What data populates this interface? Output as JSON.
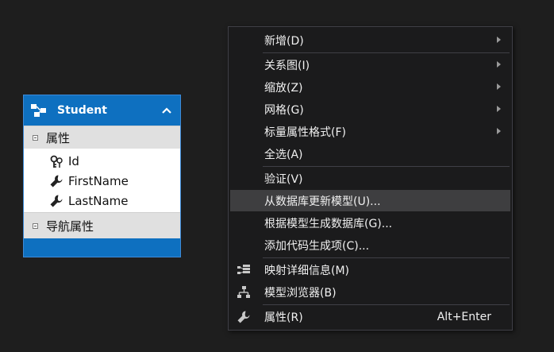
{
  "entity": {
    "title": "Student",
    "sections": [
      {
        "label": "属性",
        "properties": [
          {
            "name": "Id",
            "icon": "key-icon"
          },
          {
            "name": "FirstName",
            "icon": "wrench-icon"
          },
          {
            "name": "LastName",
            "icon": "wrench-icon"
          }
        ]
      },
      {
        "label": "导航属性",
        "properties": []
      }
    ]
  },
  "menu": {
    "items": [
      {
        "label": "新增(D)",
        "submenu": true
      },
      {
        "label": "关系图(I)",
        "submenu": true
      },
      {
        "label": "缩放(Z)",
        "submenu": true
      },
      {
        "label": "网格(G)",
        "submenu": true
      },
      {
        "label": "标量属性格式(F)",
        "submenu": true
      },
      {
        "label": "全选(A)"
      },
      {
        "label": "验证(V)"
      },
      {
        "label": "从数据库更新模型(U)...",
        "highlighted": true
      },
      {
        "label": "根据模型生成数据库(G)..."
      },
      {
        "label": "添加代码生成项(C)..."
      },
      {
        "label": "映射详细信息(M)",
        "icon": "mapping-details-icon"
      },
      {
        "label": "模型浏览器(B)",
        "icon": "model-browser-icon"
      },
      {
        "label": "属性(R)",
        "icon": "wrench-icon",
        "shortcut": "Alt+Enter"
      }
    ]
  },
  "colors": {
    "background": "#1e1e1e",
    "entity_blue": "#0e70c0",
    "menu_bg": "#1b1b1c",
    "menu_highlight": "#3e3e40"
  }
}
